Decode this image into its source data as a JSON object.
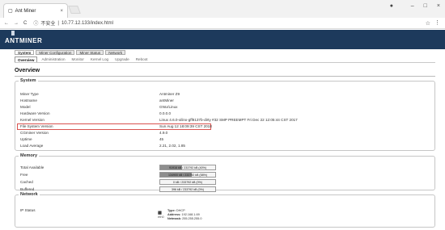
{
  "browser": {
    "tab_title": "Ant Miner",
    "tab_close": "×",
    "win_min": "–",
    "win_max": "□",
    "win_close": "×",
    "nav_back": "←",
    "nav_forward": "→",
    "nav_reload": "C",
    "insecure": "不安全",
    "url": "10.77.12.133/index.html",
    "star": "☆",
    "menu": "⋮"
  },
  "header": {
    "logo": "ANTMINER"
  },
  "nav": {
    "top": [
      {
        "label": "System",
        "active": true
      },
      {
        "label": "Miner Configuration"
      },
      {
        "label": "Miner Status"
      },
      {
        "label": "Network"
      }
    ],
    "sub": [
      {
        "label": "Overview",
        "active": true
      },
      {
        "label": "Administration"
      },
      {
        "label": "Monitor"
      },
      {
        "label": "Kernel Log"
      },
      {
        "label": "Upgrade"
      },
      {
        "label": "Reboot"
      }
    ]
  },
  "page": {
    "title": "Overview"
  },
  "system": {
    "legend": "System",
    "rows": [
      {
        "k": "Miner Type",
        "v": "Antminer Z9"
      },
      {
        "k": "Hostname",
        "v": "antMiner"
      },
      {
        "k": "Model",
        "v": "GNU/Linux"
      },
      {
        "k": "Hardware Version",
        "v": "0.0.0.0"
      },
      {
        "k": "Kernel Version",
        "v": "Linux 4.6.0-xilinx-gff8137b-dirty #32 SMP PREEMPT Fri Dec 22 12:05:44 CST 2017"
      },
      {
        "k": "File System Version",
        "v": "Sun Aug 12 18:09:39 CST 2018"
      },
      {
        "k": "CGminer Version",
        "v": "4.9.0"
      },
      {
        "k": "Uptime",
        "v": "45"
      },
      {
        "k": "Load Average",
        "v": "2.21, 2.02, 1.85"
      }
    ]
  },
  "memory": {
    "legend": "Memory",
    "rows": [
      {
        "k": "Total Available",
        "v": "91916 kB / 233792 kB (40%)",
        "fraction": 0.4
      },
      {
        "k": "Free",
        "v": "134900 kB / 233792 kB (58%)",
        "fraction": 0.58
      },
      {
        "k": "Cached",
        "v": "0 kB / 233792 kB (0%)",
        "fraction": 0.0
      },
      {
        "k": "Buffered",
        "v": "396 kB / 233792 kB (0%)",
        "fraction": 0.0
      }
    ]
  },
  "network": {
    "legend": "Network",
    "k": "IP Status",
    "type_label": "Type:",
    "type_value": "DHCP",
    "address_label": "Address:",
    "address_value": "192.168.1.69",
    "netmask_label": "Netmask:",
    "netmask_value": "255.255.255.0",
    "icon_caption": "eth0"
  }
}
